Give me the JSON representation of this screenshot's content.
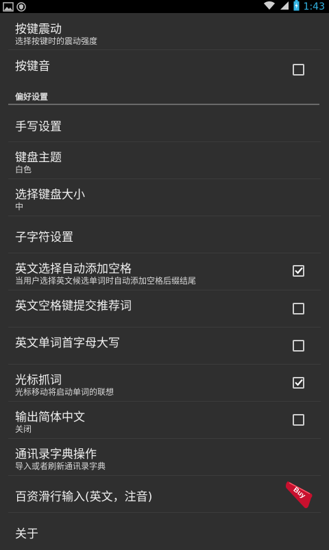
{
  "status_bar": {
    "time": "1:43",
    "icons": [
      "picture-icon",
      "shield-icon",
      "wifi-icon",
      "signal-icon",
      "battery-charging-icon"
    ],
    "accent": "#33b5e5"
  },
  "items": [
    {
      "title": "按键震动",
      "summary": "选择按键时的震动强度"
    },
    {
      "title": "按键音",
      "checked": false
    },
    {
      "section": "偏好设置"
    },
    {
      "title": "手写设置"
    },
    {
      "title": "键盘主题",
      "summary": "白色"
    },
    {
      "title": "选择键盘大小",
      "summary": "中"
    },
    {
      "title": "子字符设置"
    },
    {
      "title": "英文选择自动添加空格",
      "summary": "当用户选择英文候选单词时自动添加空格后缀结尾",
      "checked": true
    },
    {
      "title": "英文空格键提交推荐词",
      "checked": false
    },
    {
      "title": "英文单词首字母大写",
      "checked": false
    },
    {
      "title": "光标抓词",
      "summary": "光标移动将启动单词的联想",
      "checked": true
    },
    {
      "title": "输出简体中文",
      "summary": "关闭",
      "checked": false
    },
    {
      "title": "通讯录字典操作",
      "summary": "导入或者刷新通讯录字典"
    },
    {
      "title": "百资滑行输入(英文，注音)",
      "badge": "Buy"
    },
    {
      "title": "关于"
    }
  ],
  "colors": {
    "background": "#2f2f2f",
    "badge": "#c8102e"
  }
}
